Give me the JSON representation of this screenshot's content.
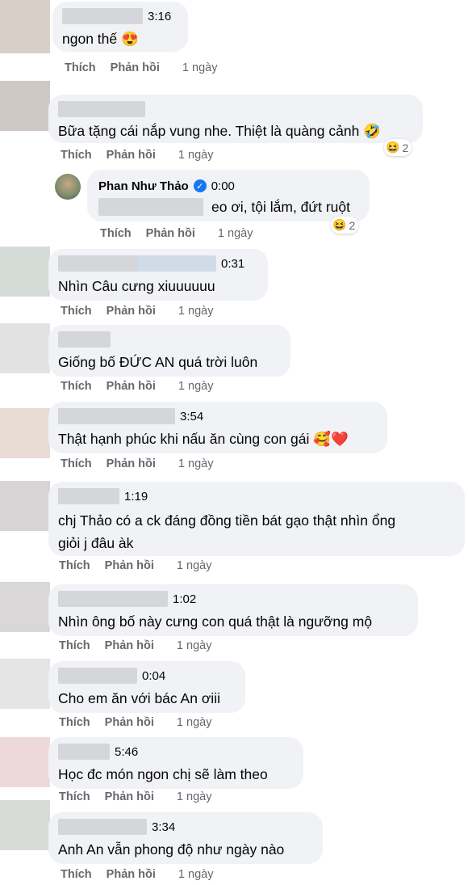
{
  "actions": {
    "like": "Thích",
    "reply": "Phản hồi",
    "time": "1 ngày"
  },
  "comments": [
    {
      "meta": "3:16",
      "text": "ngon thế 😍"
    },
    {
      "meta": "",
      "text": "Bữa tặng cái nắp vung nhe. Thiệt là quàng cảnh 🤣",
      "reaction_emoji": "😆",
      "reaction_count": "2"
    },
    {
      "author": "Phan Như Thảo",
      "meta": "0:00",
      "text": "eo ơi, tội lắm, đứt ruột",
      "reaction_emoji": "😆",
      "reaction_count": "2"
    },
    {
      "meta": "0:31",
      "text": "Nhìn Câu cưng xiuuuuuu"
    },
    {
      "meta": "",
      "text": "Giống bố ĐỨC AN quá trời luôn"
    },
    {
      "meta": "3:54",
      "text": "Thật hạnh phúc khi nấu ăn cùng con gái 🥰❤️"
    },
    {
      "meta": "1:19",
      "text": "chj Thảo có a ck đáng đồng tiền bát gạo thật nhìn ổng\ngiỏi j đâu àk"
    },
    {
      "meta": "1:02",
      "text": "Nhìn ông bố này cưng con quá thật là ngưỡng mộ"
    },
    {
      "meta": "0:04",
      "text": "Cho em ăn với bác An ơiii"
    },
    {
      "meta": "5:46",
      "text": "Học đc món ngon chị sẽ làm theo"
    },
    {
      "meta": "3:34",
      "text": "Anh An vẫn phong độ như ngày nào"
    }
  ]
}
